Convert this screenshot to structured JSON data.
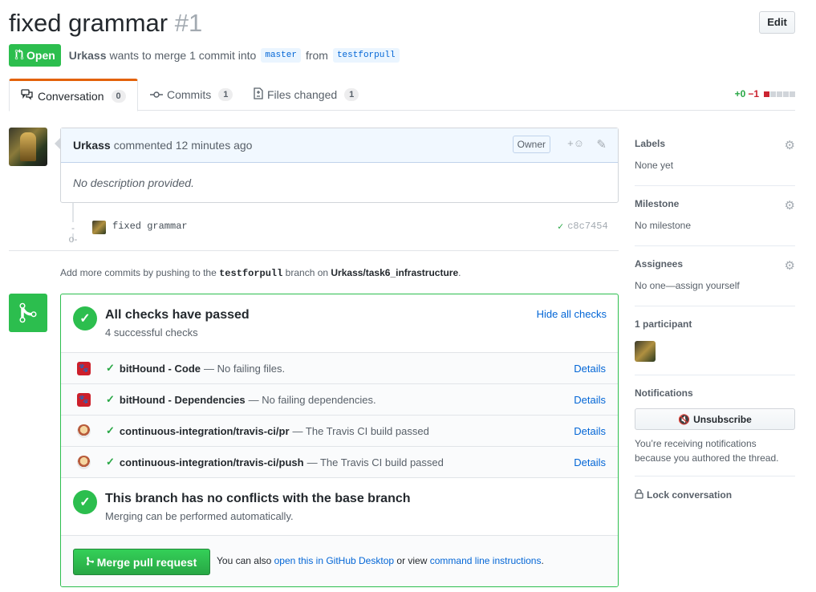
{
  "pr": {
    "title": "fixed grammar",
    "number": "#1",
    "edit_label": "Edit",
    "state": "Open",
    "author": "Urkass",
    "merge_text": "wants to merge 1 commit into",
    "base_branch": "master",
    "from_text": "from",
    "head_branch": "testforpull"
  },
  "tabs": [
    {
      "label": "Conversation",
      "count": "0"
    },
    {
      "label": "Commits",
      "count": "1"
    },
    {
      "label": "Files changed",
      "count": "1"
    }
  ],
  "diffstat": {
    "additions": "+0",
    "deletions": "−1"
  },
  "comment": {
    "author": "Urkass",
    "action": "commented 12 minutes ago",
    "role": "Owner",
    "body": "No description provided."
  },
  "commit": {
    "message": "fixed grammar",
    "sha": "c8c7454"
  },
  "push_note": {
    "prefix": "Add more commits by pushing to the",
    "branch": "testforpull",
    "middle": "branch on",
    "repo": "Urkass/task6_infrastructure",
    "suffix": "."
  },
  "checks": {
    "title": "All checks have passed",
    "subtitle": "4 successful checks",
    "hide_label": "Hide all checks",
    "items": [
      {
        "name": "bitHound - Code",
        "desc": "— No failing files.",
        "details": "Details",
        "icon": "bithound-icon"
      },
      {
        "name": "bitHound - Dependencies",
        "desc": "— No failing dependencies.",
        "details": "Details",
        "icon": "bithound-icon"
      },
      {
        "name": "continuous-integration/travis-ci/pr",
        "desc": "— The Travis CI build passed",
        "details": "Details",
        "icon": "travis-icon"
      },
      {
        "name": "continuous-integration/travis-ci/push",
        "desc": "— The Travis CI build passed",
        "details": "Details",
        "icon": "travis-icon"
      }
    ]
  },
  "conflicts": {
    "title": "This branch has no conflicts with the base branch",
    "subtitle": "Merging can be performed automatically."
  },
  "merge": {
    "button_label": "Merge pull request",
    "alt_prefix": "You can also",
    "alt_link1": "open this in GitHub Desktop",
    "alt_middle": "or view",
    "alt_link2": "command line instructions",
    "alt_suffix": "."
  },
  "sidebar": {
    "labels": {
      "title": "Labels",
      "value": "None yet"
    },
    "milestone": {
      "title": "Milestone",
      "value": "No milestone"
    },
    "assignees": {
      "title": "Assignees",
      "value": "No one—assign yourself"
    },
    "participants": {
      "title": "1 participant"
    },
    "notifications": {
      "title": "Notifications",
      "button": "Unsubscribe",
      "note": "You’re receiving notifications because you authored the thread."
    },
    "lock": "Lock conversation"
  },
  "colors": {
    "success": "#2cbe4e",
    "link": "#0366d6",
    "tab_accent": "#e36209"
  }
}
